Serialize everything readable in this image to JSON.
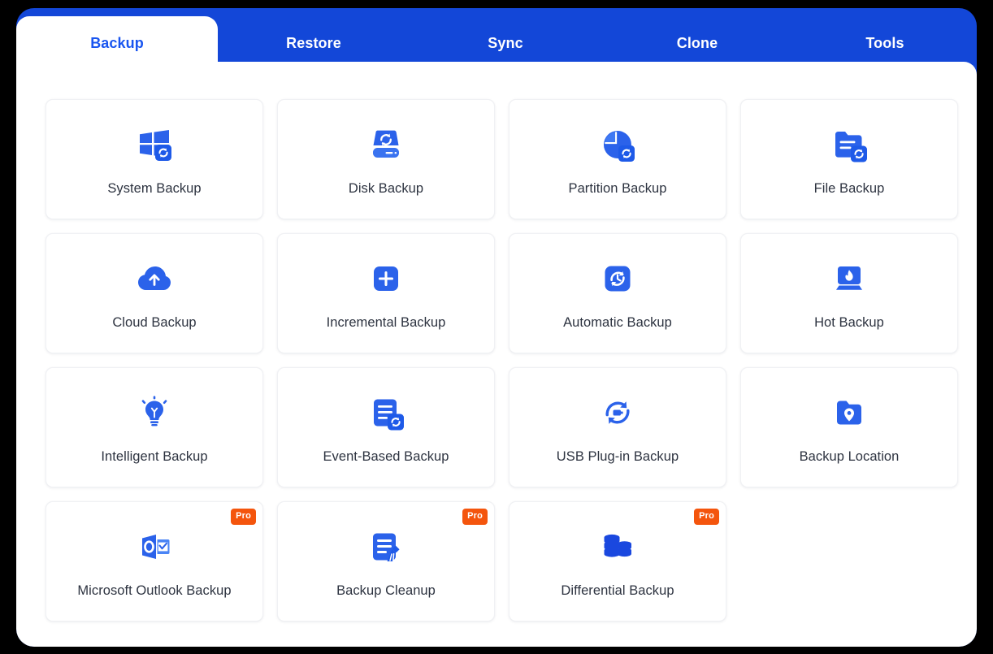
{
  "app": {
    "accent_color": "#1347d8",
    "active_tab_text_color": "#1a56f0",
    "pro_badge_color": "#f4550d",
    "card_label_color": "#2d3340"
  },
  "tabs": [
    {
      "label": "Backup",
      "active": true
    },
    {
      "label": "Restore",
      "active": false
    },
    {
      "label": "Sync",
      "active": false
    },
    {
      "label": "Clone",
      "active": false
    },
    {
      "label": "Tools",
      "active": false
    }
  ],
  "cards": [
    {
      "label": "System Backup",
      "icon": "windows-sync-icon",
      "pro": false,
      "pro_label": ""
    },
    {
      "label": "Disk Backup",
      "icon": "harddisk-sync-icon",
      "pro": false,
      "pro_label": ""
    },
    {
      "label": "Partition Backup",
      "icon": "pie-partition-sync-icon",
      "pro": false,
      "pro_label": ""
    },
    {
      "label": "File Backup",
      "icon": "folder-file-sync-icon",
      "pro": false,
      "pro_label": ""
    },
    {
      "label": "Cloud Backup",
      "icon": "cloud-upload-icon",
      "pro": false,
      "pro_label": ""
    },
    {
      "label": "Incremental Backup",
      "icon": "plus-square-icon",
      "pro": false,
      "pro_label": ""
    },
    {
      "label": "Automatic Backup",
      "icon": "clock-refresh-square-icon",
      "pro": false,
      "pro_label": ""
    },
    {
      "label": "Hot Backup",
      "icon": "laptop-flame-icon",
      "pro": false,
      "pro_label": ""
    },
    {
      "label": "Intelligent Backup",
      "icon": "lightbulb-icon",
      "pro": false,
      "pro_label": ""
    },
    {
      "label": "Event-Based Backup",
      "icon": "document-sync-icon",
      "pro": false,
      "pro_label": ""
    },
    {
      "label": "USB Plug-in Backup",
      "icon": "usb-refresh-icon",
      "pro": false,
      "pro_label": ""
    },
    {
      "label": "Backup Location",
      "icon": "folder-pin-icon",
      "pro": false,
      "pro_label": ""
    },
    {
      "label": "Microsoft Outlook Backup",
      "icon": "outlook-icon",
      "pro": true,
      "pro_label": "Pro"
    },
    {
      "label": "Backup Cleanup",
      "icon": "document-broom-icon",
      "pro": true,
      "pro_label": "Pro"
    },
    {
      "label": "Differential Backup",
      "icon": "database-stack-icon",
      "pro": true,
      "pro_label": "Pro"
    }
  ]
}
